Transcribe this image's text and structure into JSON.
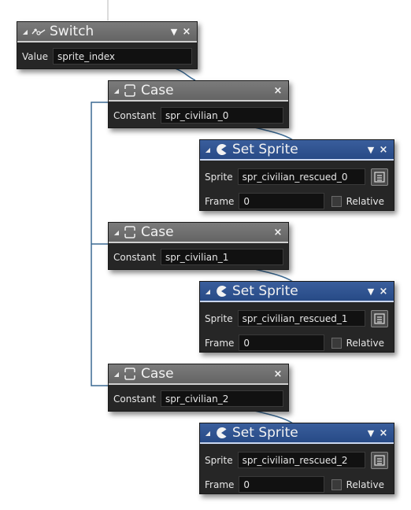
{
  "switch_block": {
    "title": "Switch",
    "value_label": "Value",
    "value": "sprite_index"
  },
  "cases": [
    {
      "title": "Case",
      "constant_label": "Constant",
      "constant": "spr_civilian_0"
    },
    {
      "title": "Case",
      "constant_label": "Constant",
      "constant": "spr_civilian_1"
    },
    {
      "title": "Case",
      "constant_label": "Constant",
      "constant": "spr_civilian_2"
    }
  ],
  "set_sprites": [
    {
      "title": "Set Sprite",
      "sprite_label": "Sprite",
      "sprite": "spr_civilian_rescued_0",
      "frame_label": "Frame",
      "frame": "0",
      "relative_label": "Relative"
    },
    {
      "title": "Set Sprite",
      "sprite_label": "Sprite",
      "sprite": "spr_civilian_rescued_1",
      "frame_label": "Frame",
      "frame": "0",
      "relative_label": "Relative"
    },
    {
      "title": "Set Sprite",
      "sprite_label": "Sprite",
      "sprite": "spr_civilian_rescued_2",
      "frame_label": "Frame",
      "frame": "0",
      "relative_label": "Relative"
    }
  ],
  "icons": {
    "switch": "switch-icon",
    "case": "case-icon",
    "set_sprite": "pacman-sprite-icon",
    "collapse": "collapse-triangle-icon",
    "menu": "dropdown-arrow-icon",
    "close": "close-icon",
    "picker": "asset-picker-icon"
  },
  "colors": {
    "block_body": "#262626",
    "gray_header": "#6e6e6e",
    "blue_header": "#2f5290",
    "connector": "#3b6a94"
  }
}
